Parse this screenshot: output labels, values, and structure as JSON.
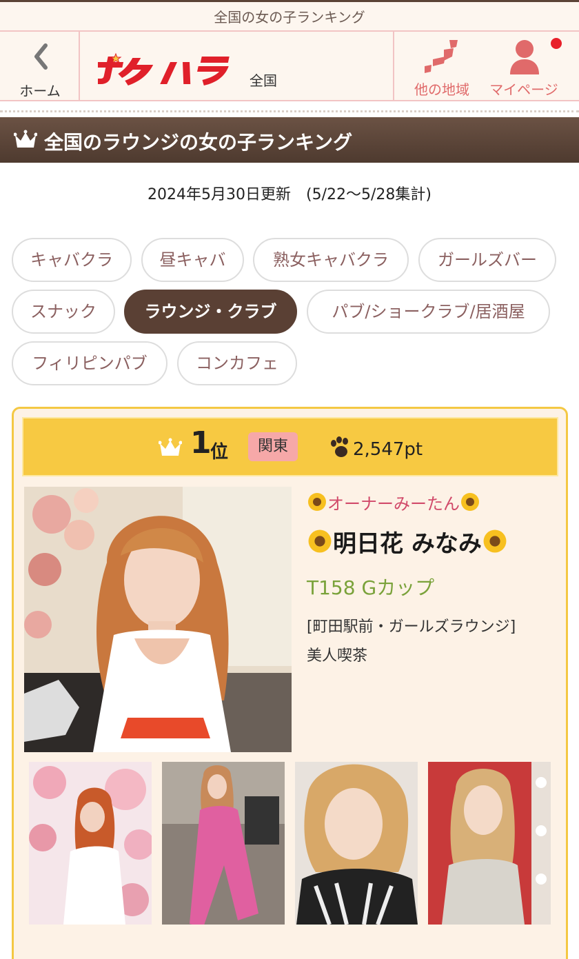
{
  "top_strip": {
    "title": "全国の女の子ランキング"
  },
  "header": {
    "back_label": "ホーム",
    "logo_text": "ポケパラ",
    "region": "全国",
    "other_region_label": "他の地域",
    "mypage_label": "マイページ"
  },
  "section_title": "全国のラウンジの女の子ランキング",
  "updated_text": "2024年5月30日更新　(5/22～5/28集計)",
  "categories": [
    {
      "label": "キャバクラ",
      "active": false
    },
    {
      "label": "昼キャバ",
      "active": false
    },
    {
      "label": "熟女キャバクラ",
      "active": false
    },
    {
      "label": "ガールズバー",
      "active": false
    },
    {
      "label": "スナック",
      "active": false
    },
    {
      "label": "ラウンジ・クラブ",
      "active": true
    },
    {
      "label": "パブ/ショークラブ/居酒屋",
      "active": false
    },
    {
      "label": "フィリピンパブ",
      "active": false
    },
    {
      "label": "コンカフェ",
      "active": false
    }
  ],
  "ranking_card": {
    "rank_number": "1",
    "rank_suffix": "位",
    "area": "関東",
    "points": "2,547pt",
    "catch_copy": "オーナーみーたん",
    "name": "明日花 みなみ",
    "spec": "T158 Gカップ",
    "shop_line1": "[町田駅前・ガールズラウンジ]",
    "shop_line2": "美人喫茶"
  },
  "colors": {
    "brown_bar": "#5a4034",
    "accent_pink": "#e06a6a",
    "logo_red": "#e0202a",
    "card_border": "#f4c843",
    "spec_green": "#7aa23a"
  }
}
